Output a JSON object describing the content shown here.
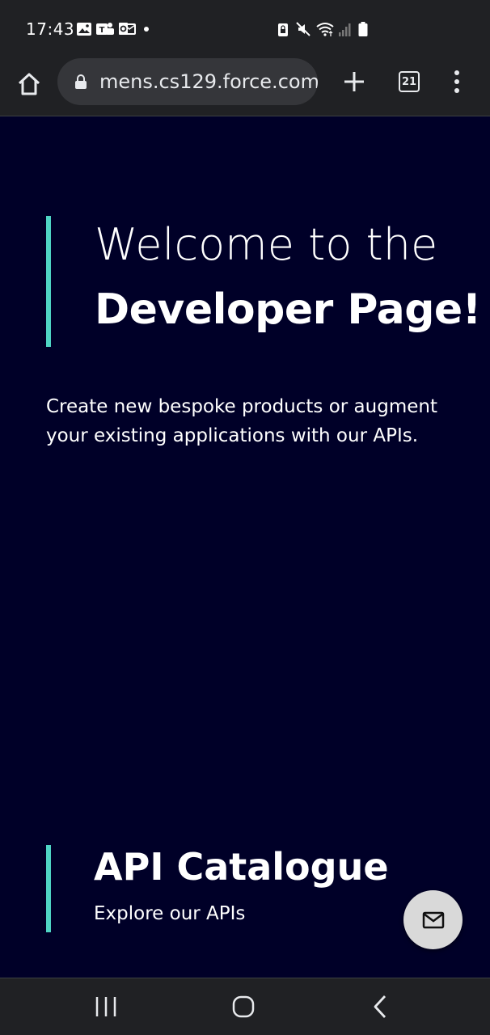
{
  "status_bar": {
    "time": "17:43",
    "left_icons": [
      "image-icon",
      "teams-icon",
      "outlook-icon"
    ],
    "right_icons": [
      "vpn-lock-icon",
      "mute-icon",
      "wifi-icon",
      "signal-icon",
      "battery-icon"
    ]
  },
  "browser": {
    "url": "mens.cs129.force.com",
    "tab_count": "21"
  },
  "hero": {
    "line1": "Welcome to the",
    "line2": "Developer Page!",
    "intro": "Create new bespoke products or augment your existing applications with our APIs.",
    "accent_color": "#4fd4c4",
    "background_color": "#000028"
  },
  "api_section": {
    "title": "API Catalogue",
    "subtitle": "Explore our APIs"
  },
  "fab": {
    "icon": "mail-icon"
  },
  "nav": {
    "items": [
      "recent-apps-icon",
      "home-icon",
      "back-icon"
    ]
  }
}
